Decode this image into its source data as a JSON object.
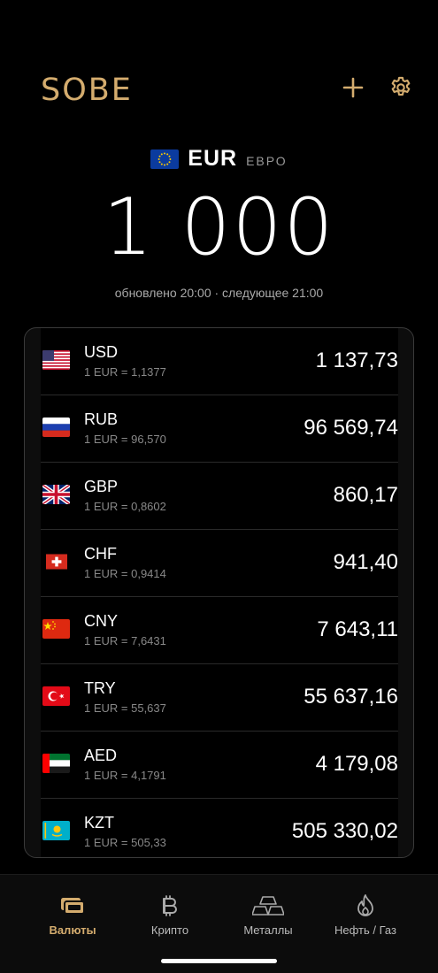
{
  "app": {
    "logo": "SOBE"
  },
  "base": {
    "code": "EUR",
    "name": "ЕВРО",
    "amount": "1 000",
    "updated": "обновлено 20:00 · следующее 21:00"
  },
  "currencies": [
    {
      "code": "USD",
      "rate": "1 EUR = 1,1377",
      "value": "1 137,73",
      "flag": "us-flag"
    },
    {
      "code": "RUB",
      "rate": "1 EUR = 96,570",
      "value": "96 569,74",
      "flag": "ru-flag"
    },
    {
      "code": "GBP",
      "rate": "1 EUR = 0,8602",
      "value": "860,17",
      "flag": "gb-flag"
    },
    {
      "code": "CHF",
      "rate": "1 EUR = 0,9414",
      "value": "941,40",
      "flag": "ch-flag"
    },
    {
      "code": "CNY",
      "rate": "1 EUR = 7,6431",
      "value": "7 643,11",
      "flag": "cn-flag"
    },
    {
      "code": "TRY",
      "rate": "1 EUR = 55,637",
      "value": "55 637,16",
      "flag": "tr-flag"
    },
    {
      "code": "AED",
      "rate": "1 EUR = 4,1791",
      "value": "4 179,08",
      "flag": "ae-flag"
    },
    {
      "code": "KZT",
      "rate": "1 EUR = 505,33",
      "value": "505 330,02",
      "flag": "kz-flag"
    }
  ],
  "tabs": [
    {
      "label": "Валюты",
      "icon": "cash-icon",
      "active": true
    },
    {
      "label": "Крипто",
      "icon": "bitcoin-icon",
      "active": false
    },
    {
      "label": "Металлы",
      "icon": "gold-bars-icon",
      "active": false
    },
    {
      "label": "Нефть / Газ",
      "icon": "flame-icon",
      "active": false
    }
  ],
  "colors": {
    "accent": "#d4ac6e",
    "background": "#000000",
    "text": "#ffffff",
    "muted": "#888888"
  }
}
